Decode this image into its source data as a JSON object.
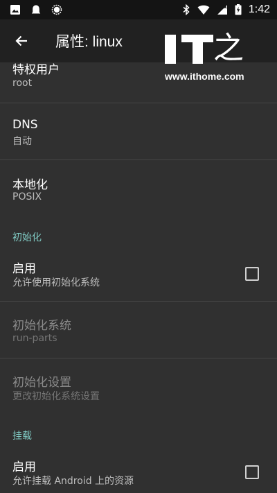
{
  "status_bar": {
    "time": "1:42",
    "left_icons": [
      "image-icon",
      "ghost-icon",
      "sync-icon"
    ],
    "right_icons": [
      "bluetooth-icon",
      "wifi-icon",
      "signal-icon",
      "battery-charging-icon"
    ]
  },
  "app_bar": {
    "title": "属性: linux"
  },
  "watermark": {
    "logo": "IT",
    "char": "之家",
    "url": "www.ithome.com"
  },
  "preferences": [
    {
      "title": "特权用户",
      "summary": "root"
    },
    {
      "title": "DNS",
      "summary": "自动"
    },
    {
      "title": "本地化",
      "summary": "POSIX"
    }
  ],
  "sections": {
    "init": {
      "header": "初始化",
      "items": [
        {
          "title": "启用",
          "summary": "允许使用初始化系统",
          "checked": false
        },
        {
          "title": "初始化系统",
          "summary": "run-parts",
          "enabled": false
        },
        {
          "title": "初始化设置",
          "summary": "更改初始化系统设置",
          "enabled": false
        }
      ]
    },
    "mount": {
      "header": "挂载",
      "items": [
        {
          "title": "启用",
          "summary": "允许挂载 Android 上的资源",
          "checked": false
        }
      ]
    }
  },
  "colors": {
    "accent": "#80cbc4",
    "background": "#303030",
    "app_bar": "#212121",
    "status_bar": "#141414"
  }
}
